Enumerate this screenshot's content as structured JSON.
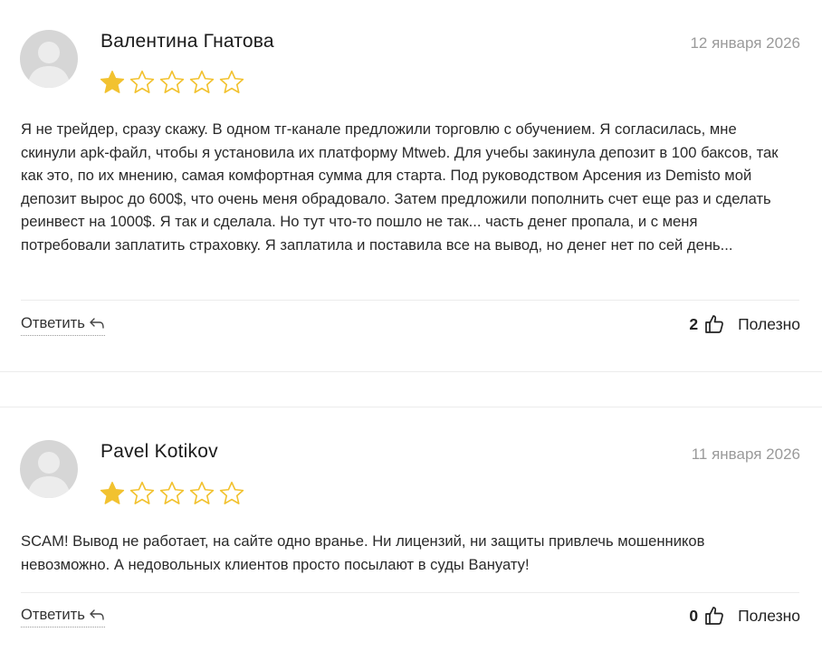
{
  "colors": {
    "star_filled": "#F2C230",
    "star_outline": "#F2C230",
    "date": "#9a9a9a",
    "avatar_bg": "#d6d6d6"
  },
  "reviews": [
    {
      "author": "Валентина Гнатова",
      "date": "12 января 2026",
      "rating": 1,
      "rating_max": 5,
      "text": "Я не трейдер, сразу скажу. В одном тг-канале предложили торговлю с обучением. Я согласилась, мне скинули apk-файл, чтобы я установила их платформу Mtweb. Для учебы закинула депозит в 100 баксов, так как это, по их мнению, самая комфортная сумма для старта. Под руководством Арсения из Demisto мой депозит вырос до 600$, что очень меня обрадовало. Затем предложили пополнить счет еще раз и сделать реинвест на 1000$. Я так и сделала. Но тут что-то пошло не так... часть денег пропала, и с меня потребовали заплатить страховку. Я заплатила и поставила все на вывод, но денег нет по сей день...",
      "reply_label": "Ответить",
      "likes": "2",
      "useful_label": "Полезно"
    },
    {
      "author": "Pavel Kotikov",
      "date": "11 января 2026",
      "rating": 1,
      "rating_max": 5,
      "text": "SCAM! Вывод не работает, на сайте одно вранье. Ни лицензий, ни защиты привлечь мошенников невозможно. А недовольных клиентов просто посылают в суды Вануату!",
      "reply_label": "Ответить",
      "likes": "0",
      "useful_label": "Полезно"
    }
  ]
}
